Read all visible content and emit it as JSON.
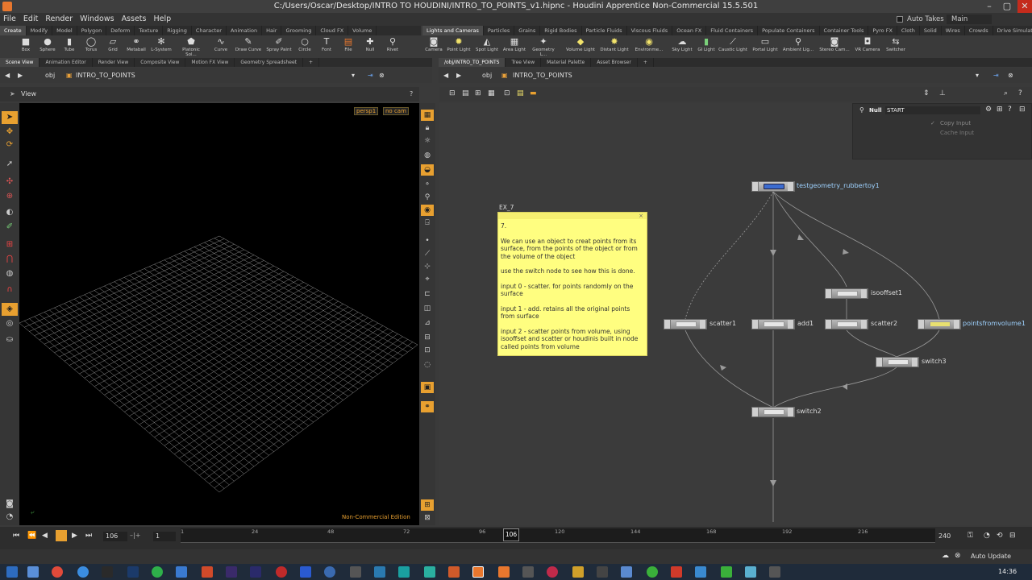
{
  "window": {
    "title": "C:/Users/Oscar/Desktop/INTRO TO HOUDINI/INTRO_TO_POINTS_v1.hipnc - Houdini Apprentice Non-Commercial 15.5.501"
  },
  "menu": {
    "items": [
      "File",
      "Edit",
      "Render",
      "Windows",
      "Assets",
      "Help"
    ],
    "auto_takes": "Auto Takes",
    "desktop": "Main"
  },
  "shelf_left": {
    "tabs": [
      "Create",
      "Modify",
      "Model",
      "Polygon",
      "Deform",
      "Texture",
      "Rigging",
      "Character",
      "Animation",
      "Hair",
      "Grooming",
      "Cloud FX",
      "Volume"
    ],
    "tools": [
      "Box",
      "Sphere",
      "Tube",
      "Torus",
      "Grid",
      "Metaball",
      "L-System",
      "Platonic Sol...",
      "Curve",
      "Draw Curve",
      "Spray Paint",
      "Circle",
      "Font",
      "File",
      "Null",
      "Rivet"
    ]
  },
  "shelf_right": {
    "tabs": [
      "Lights and Cameras",
      "Particles",
      "Grains",
      "Rigid Bodies",
      "Particle Fluids",
      "Viscous Fluids",
      "Ocean FX",
      "Fluid Containers",
      "Populate Containers",
      "Container Tools",
      "Pyro FX",
      "Cloth",
      "Solid",
      "Wires",
      "Crowds",
      "Drive Simulation"
    ],
    "tools": [
      "Camera",
      "Point Light",
      "Spot Light",
      "Area Light",
      "Geometry L...",
      "Volume Light",
      "Distant Light",
      "Environme...",
      "Sky Light",
      "GI Light",
      "Caustic Light",
      "Portal Light",
      "Ambient Lig...",
      "Stereo Cam...",
      "VR Camera",
      "Switcher"
    ]
  },
  "left_pane": {
    "tabs": [
      "Scene View",
      "Animation Editor",
      "Render View",
      "Composite View",
      "Motion FX View",
      "Geometry Spreadsheet"
    ],
    "path_obj": "obj",
    "path_node": "INTRO_TO_POINTS",
    "view_label": "View",
    "camera_persp": "persp1",
    "camera_cam": "no cam",
    "watermark": "Non-Commercial Edition"
  },
  "right_pane": {
    "tabs": [
      "/obj/INTRO_TO_POINTS",
      "Tree View",
      "Material Palette",
      "Asset Browser"
    ],
    "path_obj": "obj",
    "path_node": "INTRO_TO_POINTS",
    "param_type": "Null",
    "param_name": "START",
    "param_opts": [
      "Copy Input",
      "Cache Input"
    ]
  },
  "sticky": {
    "name": "EX_7",
    "lines": [
      "7.",
      "We can use an object to creat points from its surface, from the points of the object or from the volume of the object",
      "use the switch node to see how this is done.",
      "input 0 - scatter. for points randomly on the surface",
      "input 1 - add. retains all the original points from surface",
      "input 2 - scatter points from volume, using isooffset and scatter or houdinis built in node called points from volume"
    ]
  },
  "nodes": {
    "testgeometry": "testgeometry_rubbertoy1",
    "isooffset": "isooffset1",
    "scatter1": "scatter1",
    "add1": "add1",
    "scatter2": "scatter2",
    "pointsfromvolume": "pointsfromvolume1",
    "switch3": "switch3",
    "switch2": "switch2"
  },
  "timeline": {
    "current_frame": "106",
    "start_frame": "1",
    "end_frame": "240",
    "ticks": [
      "1",
      "24",
      "48",
      "72",
      "96",
      "120",
      "144",
      "168",
      "192",
      "216"
    ],
    "marker": "106"
  },
  "status": {
    "auto_update": "Auto Update"
  },
  "taskbar": {
    "clock": "14:36"
  }
}
